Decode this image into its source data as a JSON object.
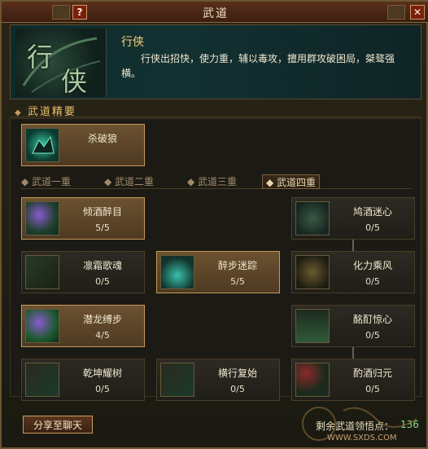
{
  "window": {
    "title": "武道",
    "help_label": "?",
    "close_label": "✕"
  },
  "header": {
    "emblem_chars": [
      "行",
      "侠"
    ],
    "class_name": "行侠",
    "class_desc": "行侠出招快，使力重，辅以毒攻，擅用群攻破困局，桀骜强横。"
  },
  "section": {
    "label": "武道精要"
  },
  "essence_skill": {
    "name": "杀破狼"
  },
  "tabs": [
    {
      "label": "武道一重",
      "selected": false
    },
    {
      "label": "武道二重",
      "selected": false
    },
    {
      "label": "武道三重",
      "selected": false
    },
    {
      "label": "武道四重",
      "selected": true
    }
  ],
  "skills": [
    {
      "name": "倾酒醉目",
      "level": "5/5",
      "active": true
    },
    {
      "name": "鸠酒迷心",
      "level": "0/5",
      "active": false
    },
    {
      "name": "凛霜歌魂",
      "level": "0/5",
      "active": false
    },
    {
      "name": "醉步迷踪",
      "level": "5/5",
      "active": true
    },
    {
      "name": "化力乘风",
      "level": "0/5",
      "active": false
    },
    {
      "name": "潜龙缚步",
      "level": "4/5",
      "active": true
    },
    {
      "name": "酩酊惊心",
      "level": "0/5",
      "active": false
    },
    {
      "name": "乾坤耀树",
      "level": "0/5",
      "active": false
    },
    {
      "name": "横行复始",
      "level": "0/5",
      "active": false
    },
    {
      "name": "酌酒归元",
      "level": "0/5",
      "active": false
    }
  ],
  "footer": {
    "share_button": "分享至聊天",
    "points_label": "剩余武道领悟点：",
    "points_value": "136"
  },
  "watermark": {
    "text": "WWW.SXDS.COM"
  },
  "colors": {
    "accent": "#c49a5a",
    "points": "#7fe07f",
    "title": "#f5cf7a"
  }
}
